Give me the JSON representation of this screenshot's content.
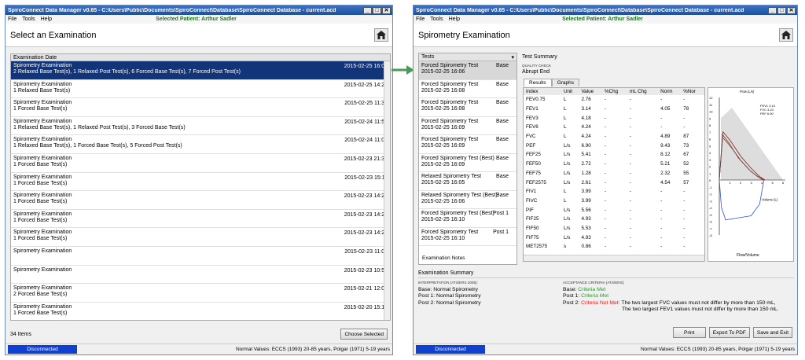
{
  "left_window": {
    "title": "SpiroConnect Data Manager v0.65 - C:\\Users\\Public\\Documents\\SpiroConnect\\Database\\SpiroConnect Database - current.acd",
    "menu": [
      "File",
      "Tools",
      "Help"
    ],
    "patient": "Selected Patient: Arthur Sadler",
    "heading": "Select an Examination",
    "list_header": "Examination Date",
    "rows": [
      {
        "name": "Spirometry Examination",
        "detail": "2 Relaxed Base Test(s), 1 Relaxed Post Test(s), 6 Forced Base Test(s), 7 Forced Post Test(s)",
        "date": "2015-02-25 16:05"
      },
      {
        "name": "Spirometry Examination",
        "detail": "1 Relaxed Base Test(s)",
        "date": "2015-02-25 14:27"
      },
      {
        "name": "Spirometry Examination",
        "detail": "1 Forced Base Test(s)",
        "date": "2015-02-25 11:34"
      },
      {
        "name": "Spirometry Examination",
        "detail": "1 Relaxed Base Test(s), 1 Relaxed Post Test(s), 3 Forced Base Test(s)",
        "date": "2015-02-24 11:56"
      },
      {
        "name": "Spirometry Examination",
        "detail": "1 Relaxed Base Test(s), 1 Forced Base Test(s), 5 Forced Post Test(s)",
        "date": "2015-02-24 11:03"
      },
      {
        "name": "Spirometry Examination",
        "detail": "1 Forced Base Test(s)",
        "date": "2015-02-23 21:35"
      },
      {
        "name": "Spirometry Examination",
        "detail": "1 Forced Base Test(s)",
        "date": "2015-02-23 15:11"
      },
      {
        "name": "Spirometry Examination",
        "detail": "1 Forced Base Test(s)",
        "date": "2015-02-23 14:27"
      },
      {
        "name": "Spirometry Examination",
        "detail": "1 Forced Base Test(s)",
        "date": "2015-02-23 14:24"
      },
      {
        "name": "Spirometry Examination",
        "detail": "1 Forced Base Test(s)",
        "date": "2015-02-23 14:22"
      },
      {
        "name": "Spirometry Examination",
        "detail": "",
        "date": "2015-02-23 11:08"
      },
      {
        "name": "Spirometry Examination",
        "detail": "",
        "date": "2015-02-23 10:56"
      },
      {
        "name": "Spirometry Examination",
        "detail": "2 Forced Base Test(s)",
        "date": "2015-02-21 12:05"
      },
      {
        "name": "Spirometry Examination",
        "detail": "1 Forced Base Test(s)",
        "date": "2015-02-20 15:18"
      }
    ],
    "items_count": "34 Items",
    "choose_button": "Choose Selected",
    "status": "Disconnected",
    "normal_values": "Normal Values: ECCS (1993) 20-85 years, Polgar (1971) 5-19 years"
  },
  "right_window": {
    "title": "SpiroConnect Data Manager v0.65 - C:\\Users\\Public\\Documents\\SpiroConnect\\Database\\SpiroConnect Database - current.acd",
    "menu": [
      "File",
      "Tools",
      "Help"
    ],
    "patient": "Selected Patient: Arthur Sadler",
    "heading": "Spirometry Examination",
    "tests_header": "Tests",
    "tests": [
      {
        "name": "Forced Spirometry Test",
        "date": "2015-02-25 16:06",
        "phase": "Base"
      },
      {
        "name": "Forced Spirometry Test",
        "date": "2015-02-25 16:08",
        "phase": "Base"
      },
      {
        "name": "Forced Spirometry Test",
        "date": "2015-02-25 16:08",
        "phase": "Base"
      },
      {
        "name": "Forced Spirometry Test",
        "date": "2015-02-25 16:09",
        "phase": "Base"
      },
      {
        "name": "Forced Spirometry Test",
        "date": "2015-02-25 16:09",
        "phase": "Base"
      },
      {
        "name": "Forced Spirometry Test (Best)",
        "date": "2015-02-25 16:09",
        "phase": "Base"
      },
      {
        "name": "Relaxed Spirometry Test",
        "date": "2015-02-25 16:05",
        "phase": "Base"
      },
      {
        "name": "Relaxed Spirometry Test (Best)",
        "date": "2015-02-25 16:06",
        "phase": "Base"
      },
      {
        "name": "Forced Spirometry Test (Best)",
        "date": "2015-02-25 16:10",
        "phase": "Post 1"
      },
      {
        "name": "Forced Spirometry Test",
        "date": "2015-02-25 16:10",
        "phase": "Post 1"
      }
    ],
    "examination_notes": "Examination Notes",
    "test_summary": "Test Summary",
    "quality_check_label": "QUALITY CHECK",
    "quality_check_value": "Abrupt End",
    "tabs": [
      "Results",
      "Graphs"
    ],
    "table_headers": [
      "Index",
      "Unit",
      "Value",
      "%Chg",
      "mL Chg",
      "Norm",
      "%Nor"
    ],
    "table_rows": [
      [
        "FEV0.75",
        "L",
        "2.76",
        "-",
        "-",
        "-",
        "-"
      ],
      [
        "FEV1",
        "L",
        "3.14",
        "-",
        "-",
        "4.05",
        "78"
      ],
      [
        "FEV3",
        "L",
        "4.18",
        "-",
        "-",
        "-",
        "-"
      ],
      [
        "FEV6",
        "L",
        "4.24",
        "-",
        "-",
        "-",
        "-"
      ],
      [
        "FVC",
        "L",
        "4.24",
        "-",
        "-",
        "4.89",
        "87"
      ],
      [
        "PEF",
        "L/s",
        "6.90",
        "-",
        "-",
        "9.43",
        "73"
      ],
      [
        "FEF25",
        "L/s",
        "5.41",
        "-",
        "-",
        "8.12",
        "67"
      ],
      [
        "FEF50",
        "L/s",
        "2.72",
        "-",
        "-",
        "5.21",
        "52"
      ],
      [
        "FEF75",
        "L/s",
        "1.28",
        "-",
        "-",
        "2.32",
        "55"
      ],
      [
        "FEF2575",
        "L/s",
        "2.61",
        "-",
        "-",
        "4.54",
        "57"
      ],
      [
        "FIV1",
        "L",
        "3.99",
        "-",
        "-",
        "-",
        "-"
      ],
      [
        "FIVC",
        "L",
        "3.99",
        "-",
        "-",
        "-",
        "-"
      ],
      [
        "PIF",
        "L/s",
        "5.56",
        "-",
        "-",
        "-",
        "-"
      ],
      [
        "FIF25",
        "L/s",
        "4.93",
        "-",
        "-",
        "-",
        "-"
      ],
      [
        "FIF50",
        "L/s",
        "5.53",
        "-",
        "-",
        "-",
        "-"
      ],
      [
        "FIF75",
        "L/s",
        "4.93",
        "-",
        "-",
        "-",
        "-"
      ],
      [
        "MET2575",
        "s",
        "0.86",
        "-",
        "-",
        "-",
        "-"
      ]
    ],
    "graph": {
      "ylabel": "Flow (L/s)",
      "xlabel": "Volume (L)",
      "caption": "Flow/Volume",
      "legend": [
        "FEV1  3.14",
        "FVC  4.24",
        "PEF  6.90"
      ],
      "yticks": [
        "12",
        "11",
        "10",
        "9",
        "8",
        "7",
        "6",
        "5",
        "4",
        "3",
        "2",
        "1",
        "0",
        "-1",
        "-2",
        "-3",
        "-4",
        "-5",
        "-6",
        "-7",
        "-8"
      ],
      "xticks": [
        "1",
        "2",
        "3",
        "4",
        "5",
        "6"
      ]
    },
    "exam_summary": "Examination Summary",
    "interpretation_label": "INTERPRETATION (ATS/ERS 2005):",
    "interpretation": [
      "Base: Normal Spirometry",
      "Post 1: Normal Spirometry",
      "Post 2: Normal Spirometry"
    ],
    "acceptance_label": "ACCEPTANCE CRITERIA (ATS/ERS):",
    "acceptance": [
      {
        "phase": "Base:",
        "status": "Criteria Met",
        "note": ""
      },
      {
        "phase": "Post 1:",
        "status": "Criteria Met",
        "note": ""
      },
      {
        "phase": "Post 2:",
        "status": "Criteria Not Met:",
        "note": "The two largest FVC values must not differ by more than 150 mL,"
      }
    ],
    "acceptance_note2": "The two largest FEV1 values must not differ by more than 150 mL.",
    "buttons": [
      "Print",
      "Export To PDF",
      "Save and Exit"
    ],
    "status": "Disconnected",
    "normal_values": "Normal Values: ECCS (1993) 20-85 years, Polgar (1971) 5-19 years"
  },
  "colors": {
    "selected_row": "#12357a",
    "criteria_met": "#22a022",
    "criteria_not_met": "#e02020",
    "patient": "#1f7a1f",
    "arrow": "#4a9a5a"
  }
}
